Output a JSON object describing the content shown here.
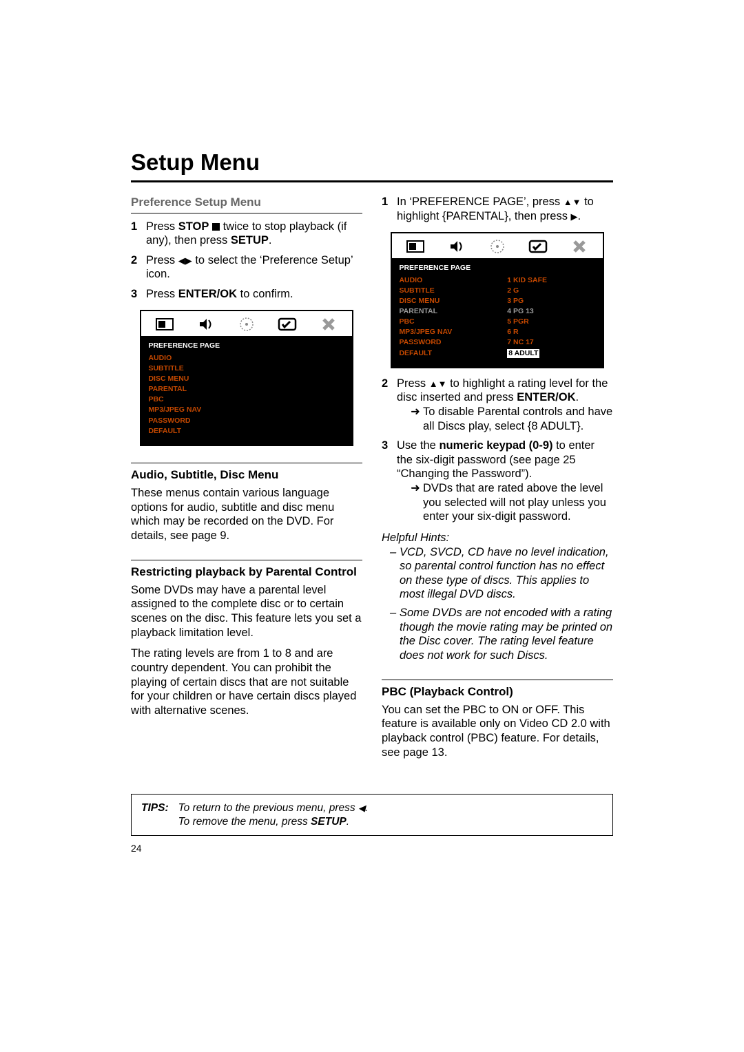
{
  "title": "Setup Menu",
  "left": {
    "pref_header": "Preference Setup Menu",
    "step1_a": "Press ",
    "step1_b": "STOP",
    "step1_c": " twice to stop playback (if any), then press ",
    "step1_d": "SETUP",
    "step1_e": ".",
    "step2": "Press ◀▶ to select the ‘Preference Setup’ icon.",
    "step3_a": "Press ",
    "step3_b": "ENTER/OK",
    "step3_c": " to confirm.",
    "osd_title": "PREFERENCE PAGE",
    "osd_rows": [
      "AUDIO",
      "SUBTITLE",
      "DISC MENU",
      "PARENTAL",
      "PBC",
      "MP3/JPEG NAV",
      "PASSWORD",
      "DEFAULT"
    ],
    "sub1_h": "Audio, Subtitle, Disc Menu",
    "sub1_p": "These menus contain various language options for audio, subtitle and disc menu which may be recorded on the DVD. For details, see page 9.",
    "sub2_h": "Restricting playback by Parental Control",
    "sub2_p1": "Some DVDs may have a parental level assigned to the complete disc or to certain scenes on the disc. This feature lets you set a playback limitation level.",
    "sub2_p2": "The rating levels are from 1 to 8 and are country dependent. You can prohibit the playing of certain discs that are not suitable for your children or have certain discs played with alternative scenes."
  },
  "right": {
    "s1": "In ‘PREFERENCE PAGE’, press ▲▼ to highlight {PARENTAL}, then press ▶.",
    "osd_title": "PREFERENCE PAGE",
    "osd_left": [
      "AUDIO",
      "SUBTITLE",
      "DISC MENU",
      "PARENTAL",
      "PBC",
      "MP3/JPEG NAV",
      "PASSWORD",
      "DEFAULT"
    ],
    "osd_right": [
      "1 KID SAFE",
      "2 G",
      "3 PG",
      "4 PG 13",
      "5 PGR",
      "6 R",
      "7 NC 17",
      "8 ADULT"
    ],
    "s2_a": "Press ▲▼ to highlight a rating level for the disc inserted and press ",
    "s2_b": "ENTER/OK",
    "s2_c": ".",
    "s2_bullet": "To disable Parental controls and have all Discs play, select {8 ADULT}.",
    "s3_a": "Use the ",
    "s3_b": "numeric keypad (0-9)",
    "s3_c": " to enter the six-digit password (see page 25 “Changing the Password”).",
    "s3_bullet": "DVDs that are rated above the level you selected will not play unless you enter your six-digit password.",
    "hints_label": "Helpful Hints:",
    "hints": [
      "VCD, SVCD, CD have no level indication, so parental control function has no effect on these type of discs. This applies to most illegal DVD discs.",
      "Some DVDs are not encoded with a rating though the movie rating may be printed on the Disc cover. The rating level feature does not work for such Discs."
    ],
    "pbc_h": "PBC (Playback Control)",
    "pbc_p": "You can set the PBC to ON or OFF. This feature is available only on Video CD 2.0 with playback control (PBC) feature. For details, see page 13."
  },
  "tips_label": "TIPS:",
  "tips_l1": "To return to the previous menu, press ◀.",
  "tips_l2_a": "To remove the menu, press ",
  "tips_l2_b": "SETUP",
  "tips_l2_c": ".",
  "page_num": "24"
}
